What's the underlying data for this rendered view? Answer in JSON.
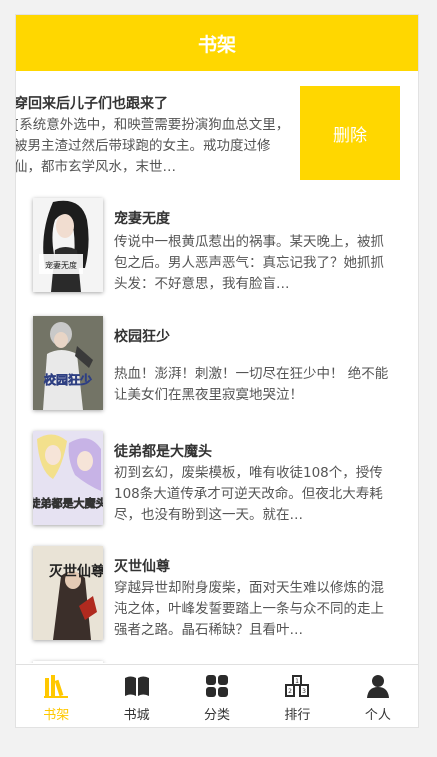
{
  "header": {
    "title": "书架"
  },
  "swiped_item": {
    "title": "穿回来后儿子们也跟来了",
    "desc": "[系统意外选中，和映萱需要扮演狗血总文里，被男主渣过然后带球跑的女主。戒功度过修仙，都市玄学风水，末世…",
    "delete_label": "删除"
  },
  "books": [
    {
      "title": "宠妻无度",
      "desc": "传说中一根黄瓜惹出的祸事。某天晚上，被抓包之后。男人恶声恶气：真忘记我了？她抓抓头发：不好意思，我有脸盲…",
      "cover_text": "宠妻无度"
    },
    {
      "title": "校园狂少",
      "desc": "热血！澎湃！刺激！一切尽在狂少中！ 绝不能让美女们在黑夜里寂寞地哭泣！",
      "cover_text": "校园狂少"
    },
    {
      "title": "徒弟都是大魔头",
      "desc": "初到玄幻，废柴模板，唯有收徒108个，授传108条大道传承才可逆天改命。但夜北大寿耗尽，也没有盼到这一天。就在…",
      "cover_text": "徒弟都是大魔头"
    },
    {
      "title": "灭世仙尊",
      "desc": "穿越异世却附身废柴，面对天生难以修炼的混沌之体，叶峰发誓要踏上一条与众不同的走上强者之路。晶石稀缺？且看叶…",
      "cover_text": "灭世仙尊"
    }
  ],
  "tabs": [
    {
      "label": "书架",
      "icon": "bookshelf-icon",
      "active": true
    },
    {
      "label": "书城",
      "icon": "open-book-icon",
      "active": false
    },
    {
      "label": "分类",
      "icon": "category-grid-icon",
      "active": false
    },
    {
      "label": "排行",
      "icon": "podium-icon",
      "active": false
    },
    {
      "label": "个人",
      "icon": "person-icon",
      "active": false
    }
  ],
  "colors": {
    "accent": "#ffd700",
    "active_tab": "#ffc800"
  }
}
